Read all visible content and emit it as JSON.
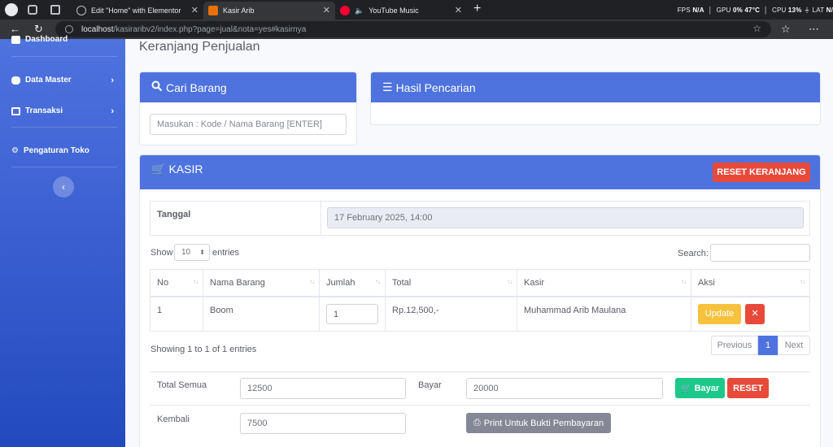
{
  "browser": {
    "tabs": [
      {
        "title": "Edit \"Home\" with Elementor"
      },
      {
        "title": "Kasir Arib"
      },
      {
        "title": "YouTube Music"
      }
    ],
    "perf": {
      "fps_label": "FPS",
      "fps_value": "N/A",
      "gpu_label": "GPU",
      "gpu_value": "0%",
      "gpu_temp": "47°C",
      "cpu_label": "CPU",
      "cpu_value": "13%",
      "lat_label": "LAT",
      "lat_value": "N/"
    },
    "url_host": "localhost",
    "url_path": "/kasiraribv2/index.php?page=jual&nota=yes#kasirnya"
  },
  "sidebar": {
    "items": [
      {
        "label": "Dashboard",
        "icon": "dashboard-icon"
      },
      {
        "label": "Data Master",
        "icon": "database-icon"
      },
      {
        "label": "Transaksi",
        "icon": "monitor-icon"
      },
      {
        "label": "Pengaturan Toko",
        "icon": "cogs-icon"
      }
    ],
    "colors": {
      "from": "#4e73df",
      "to": "#224abe"
    }
  },
  "page": {
    "title": "Keranjang Penjualan"
  },
  "cari": {
    "title": "Cari Barang",
    "placeholder": "Masukan : Kode / Nama Barang  [ENTER]"
  },
  "hasil": {
    "title": "Hasil Pencarian"
  },
  "kasir": {
    "title": "KASIR",
    "reset_label": "RESET KERANJANG",
    "tanggal_label": "Tanggal",
    "tanggal_value": "17 February 2025, 14:00",
    "show_label": "Show",
    "entries_value": "10",
    "entries_label": "entries",
    "search_label": "Search:",
    "columns": [
      "No",
      "Nama Barang",
      "Jumlah",
      "Total",
      "Kasir",
      "Aksi"
    ],
    "rows": [
      {
        "no": "1",
        "nama": "Boom",
        "jumlah": "1",
        "total": "Rp.12,500,-",
        "kasir": "Muhammad Arib Maulana",
        "update_label": "Update",
        "delete_label": "✕"
      }
    ],
    "info": "Showing 1 to 1 of 1 entries",
    "pager": {
      "prev": "Previous",
      "page": "1",
      "next": "Next"
    },
    "total_semua_label": "Total Semua",
    "total_semua_value": "12500",
    "bayar_label": "Bayar",
    "bayar_value": "20000",
    "bayar_button": "Bayar",
    "reset_button": "RESET",
    "kembali_label": "Kembali",
    "kembali_value": "7500",
    "print_button": "Print Untuk Bukti Pembayaran"
  },
  "colors": {
    "primary": "#4e73df",
    "danger": "#e74a3b",
    "warning": "#f6c23e",
    "success": "#1cc88a",
    "secondary": "#858796"
  }
}
